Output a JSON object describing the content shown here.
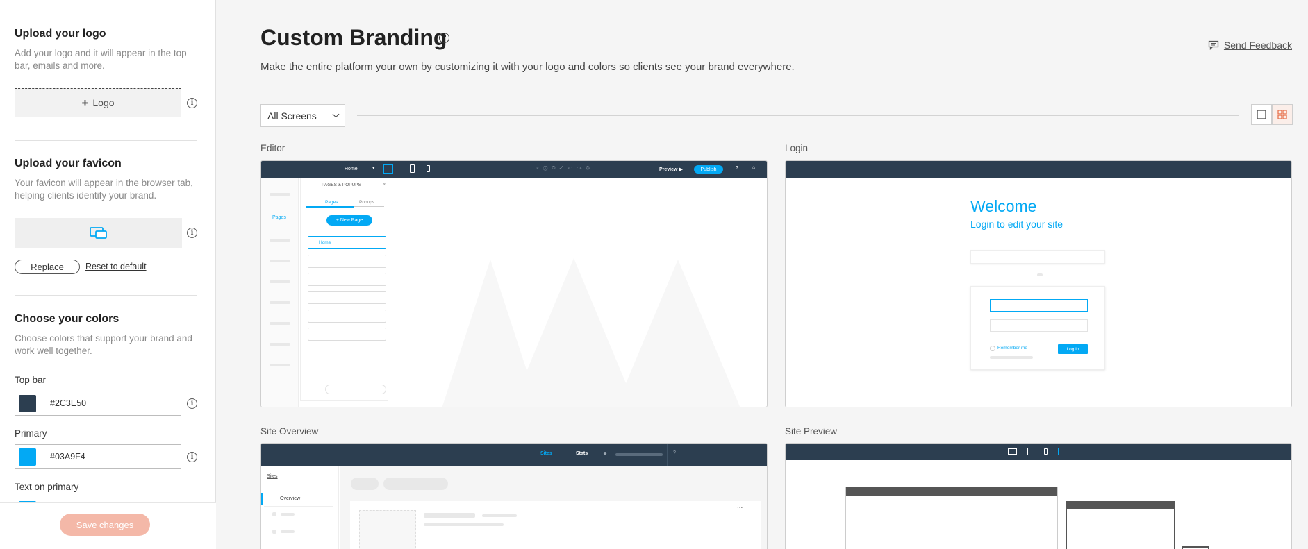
{
  "sidebar": {
    "logo": {
      "title": "Upload your logo",
      "desc": "Add your logo and it will appear in the top bar, emails and more.",
      "button": "Logo"
    },
    "favicon": {
      "title": "Upload your favicon",
      "desc": "Your favicon will appear in the browser tab, helping clients identify your brand.",
      "replace": "Replace",
      "reset": "Reset to default"
    },
    "colors": {
      "title": "Choose your colors",
      "desc": "Choose colors that support your brand and work well together.",
      "fields": [
        {
          "label": "Top bar",
          "value": "#2C3E50",
          "color": "#2c3e50"
        },
        {
          "label": "Primary",
          "value": "#03A9F4",
          "color": "#03a9f4"
        },
        {
          "label": "Text on primary",
          "value": "",
          "color": "#03a9f4"
        }
      ]
    },
    "save": "Save changes"
  },
  "main": {
    "title": "Custom Branding",
    "subtitle": "Make the entire platform your own by customizing it with your logo and colors so clients see your brand everywhere.",
    "feedback": "Send Feedback",
    "filter": "All Screens",
    "cards": {
      "editor": {
        "label": "Editor",
        "home": "Home",
        "preview": "Preview ▶",
        "publish": "Publish",
        "panel_title": "PAGES & POPUPS",
        "tab_pages": "Pages",
        "tab_popups": "Popups",
        "new_page": "+ New Page",
        "page_home": "Home",
        "side_pages": "Pages"
      },
      "login": {
        "label": "Login",
        "welcome": "Welcome",
        "sub": "Login to edit your site",
        "remember": "Remember me",
        "login_btn": "Log In"
      },
      "overview": {
        "label": "Site Overview",
        "sites": "Sites",
        "stats": "Stats",
        "back": "Sites",
        "nav_overview": "Overview",
        "menu": "..."
      },
      "preview": {
        "label": "Site Preview"
      }
    }
  },
  "colors": {
    "accent": "#03a9f4",
    "topbar": "#2c3e50",
    "save": "#f4b8a8",
    "toggle_active": "#e8734f"
  }
}
